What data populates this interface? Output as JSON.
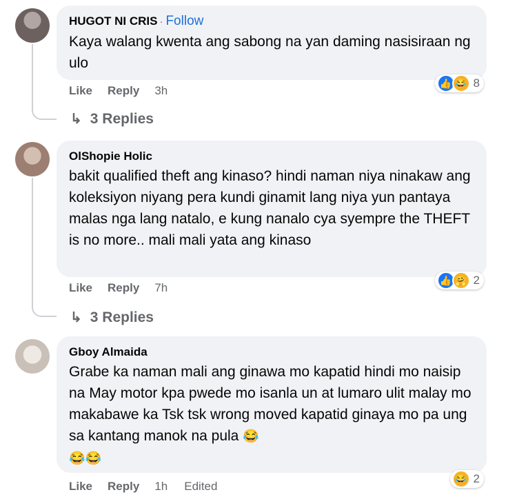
{
  "comments": [
    {
      "author": "HUGOT NI CRIS",
      "follow_sep": "·",
      "follow": "Follow",
      "text": "Kaya walang kwenta ang sabong na yan daming nasisiraan ng ulo",
      "like": "Like",
      "reply": "Reply",
      "time": "3h",
      "reaction_count": "8",
      "replies_label": "3 Replies",
      "avatar_color": "#8a7d7b"
    },
    {
      "author": "OlShopie Holic",
      "text": "bakit qualified theft ang kinaso? hindi naman niya ninakaw ang koleksiyon niyang pera kundi ginamit lang niya yun pantaya malas nga lang natalo, e kung nanalo cya syempre the THEFT is no more.. mali mali yata ang kinaso",
      "like": "Like",
      "reply": "Reply",
      "time": "7h",
      "reaction_count": "2",
      "replies_label": "3 Replies",
      "avatar_color": "#b79c8e"
    },
    {
      "author": "Gboy Almaida",
      "text": "Grabe ka naman mali ang ginawa mo kapatid hindi mo naisip na May motor kpa pwede mo isanla un at lumaro ulit malay mo makabawe ka Tsk tsk wrong moved kapatid ginaya mo pa ung sa kantang manok na pula",
      "like": "Like",
      "reply": "Reply",
      "time": "1h",
      "edited": "Edited",
      "reaction_count": "2",
      "avatar_color": "#d8d2cc"
    }
  ],
  "colors": {
    "bubble": "#f0f2f5",
    "link": "#216fdb",
    "meta": "#65676b"
  },
  "icons": [
    "like-reaction-icon",
    "haha-reaction-icon",
    "reply-arrow-icon"
  ]
}
